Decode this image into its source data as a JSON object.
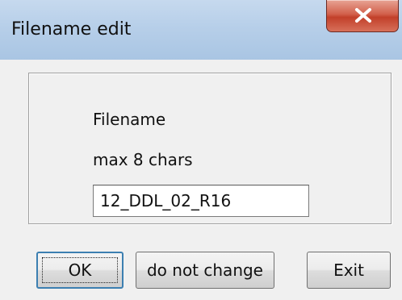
{
  "window": {
    "title": "Filename edit"
  },
  "dialog": {
    "label_filename": "Filename",
    "label_limit": "max 8 chars",
    "filename_value": "12_DDL_02_R16"
  },
  "buttons": {
    "ok": "OK",
    "do_not_change": "do not change",
    "exit": "Exit"
  },
  "icons": {
    "close": "close-icon"
  },
  "colors": {
    "titlebar": "#b7cfe9",
    "close_button": "#c8472f",
    "dialog_background": "#f0f0f0",
    "ok_focus_border": "#3c7fb1"
  }
}
